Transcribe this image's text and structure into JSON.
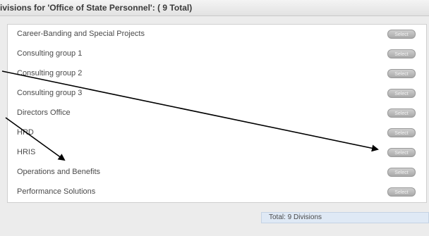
{
  "header": {
    "title": "ivisions for 'Office of State Personnel': ( 9 Total)"
  },
  "divisions": [
    {
      "label": "Career-Banding and Special Projects",
      "button": "Select"
    },
    {
      "label": "Consulting group 1",
      "button": "Select"
    },
    {
      "label": "Consulting group 2",
      "button": "Select"
    },
    {
      "label": "Consulting group 3",
      "button": "Select"
    },
    {
      "label": "Directors Office",
      "button": "Select"
    },
    {
      "label": "HRD",
      "button": "Select"
    },
    {
      "label": "HRIS",
      "button": "Select"
    },
    {
      "label": "Operations and Benefits",
      "button": "Select"
    },
    {
      "label": "Performance Solutions",
      "button": "Select"
    }
  ],
  "footer": {
    "total": "Total: 9 Divisions"
  },
  "colors": {
    "panel": "#ffffff",
    "header": "#e8e8e8",
    "total_bg": "#dfe9f5",
    "annotation": "#000000"
  }
}
